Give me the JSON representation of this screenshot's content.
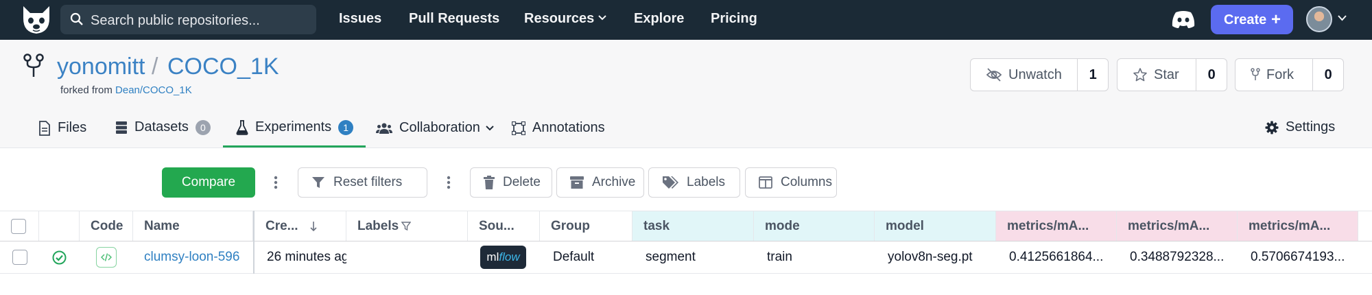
{
  "nav": {
    "search_placeholder": "Search public repositories...",
    "links": [
      "Issues",
      "Pull Requests",
      "Resources",
      "Explore",
      "Pricing"
    ],
    "create_label": "Create",
    "create_plus": "+"
  },
  "repo": {
    "owner": "yonomitt",
    "separator": "/",
    "name": "COCO_1K",
    "forked_prefix": "forked from",
    "forked_source": "Dean/COCO_1K",
    "unwatch_label": "Unwatch",
    "unwatch_count": "1",
    "star_label": "Star",
    "star_count": "0",
    "fork_label": "Fork",
    "fork_count": "0"
  },
  "tabs": {
    "files": "Files",
    "datasets": "Datasets",
    "datasets_count": "0",
    "experiments": "Experiments",
    "experiments_count": "1",
    "collaboration": "Collaboration",
    "annotations": "Annotations",
    "settings": "Settings"
  },
  "toolbar": {
    "compare": "Compare",
    "reset_filters": "Reset filters",
    "delete": "Delete",
    "archive": "Archive",
    "labels": "Labels",
    "columns": "Columns"
  },
  "table": {
    "headers": {
      "code": "Code",
      "name": "Name",
      "created": "Cre...",
      "labels": "Labels",
      "source": "Sou...",
      "group": "Group",
      "task": "task",
      "mode": "mode",
      "model": "model",
      "metric1": "metrics/mA...",
      "metric2": "metrics/mA...",
      "metric3": "metrics/mA..."
    },
    "row": {
      "name": "clumsy-loon-596",
      "created": "26 minutes ag",
      "source_ml": "ml",
      "source_flow": "flow",
      "group": "Default",
      "task": "segment",
      "mode": "train",
      "model": "yolov8n-seg.pt",
      "metric1": "0.4125661864...",
      "metric2": "0.3488792328...",
      "metric3": "0.5706674193..."
    }
  },
  "colors": {
    "nav_bg": "#1b2a36",
    "link_blue": "#3b82c4",
    "compare_green": "#23a84f",
    "create_purple": "#5b6bf0",
    "params_header": "#e1f6f8",
    "metrics_header": "#f8dde8"
  }
}
